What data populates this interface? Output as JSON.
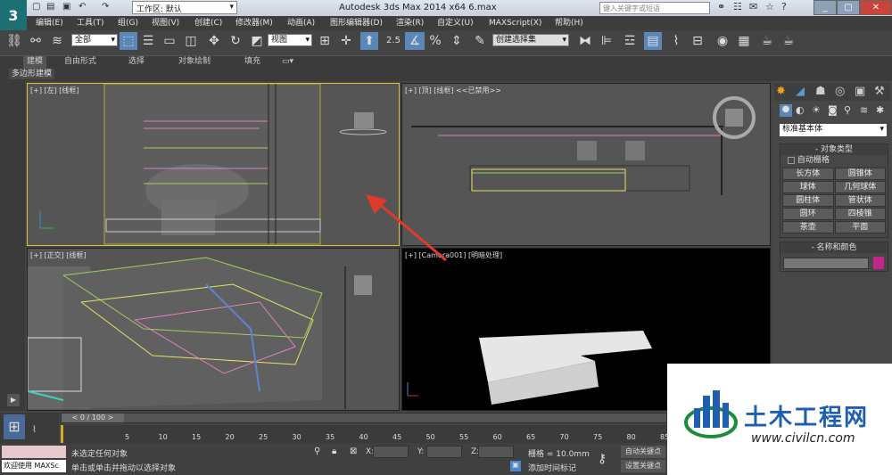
{
  "app": {
    "title": "Autodesk 3ds Max  2014 x64     6.max",
    "workspace": "工作区: 默认",
    "search_placeholder": "键入关键字或短语",
    "logo": "3"
  },
  "menu": [
    "编辑(E)",
    "工具(T)",
    "组(G)",
    "视图(V)",
    "创建(C)",
    "修改器(M)",
    "动画(A)",
    "图形编辑器(D)",
    "渲染(R)",
    "自定义(U)",
    "MAXScript(X)",
    "帮助(H)"
  ],
  "toolbar": {
    "selection_filter": "全部",
    "ref_coord": "视图",
    "named_selection": "创建选择集"
  },
  "ribbon_tabs": [
    "建模",
    "自由形式",
    "选择",
    "对象绘制",
    "填充"
  ],
  "ribbon_sub": "多边形建模",
  "viewports": {
    "top_left": "[+] [左] [线框]",
    "top_right": "[+] [顶] [线框] <<已禁用>>",
    "bottom_left": "[+] [正交] [线框]",
    "bottom_right": "[+] [Camera001] [明暗处理]"
  },
  "command_panel": {
    "category": "标准基本体",
    "object_type_header": "对象类型",
    "autogrid": "自动栅格",
    "buttons": [
      "长方体",
      "圆锥体",
      "球体",
      "几何球体",
      "圆柱体",
      "管状体",
      "圆环",
      "四棱锥",
      "茶壶",
      "平面"
    ],
    "name_color_header": "名称和颜色",
    "swatch_color": "#c2268a"
  },
  "timeline": {
    "frame_counter": "0 / 100",
    "ticks": [
      "5",
      "10",
      "15",
      "20",
      "25",
      "30",
      "35",
      "40",
      "45",
      "50",
      "55",
      "60",
      "65",
      "70",
      "75",
      "80",
      "85"
    ]
  },
  "status": {
    "script_listener": "欢迎使用 MAXSc",
    "line1": "未选定任何对象",
    "line2": "单击或单击并拖动以选择对象",
    "x_label": "X:",
    "y_label": "Y:",
    "z_label": "Z:",
    "grid": "栅格 = 10.0mm",
    "add_time_tag": "添加时间标记",
    "auto_key": "自动关键点",
    "set_key": "设置关键点"
  },
  "watermark": {
    "brand": "土木工程网",
    "url": "www.civilcn.com"
  }
}
